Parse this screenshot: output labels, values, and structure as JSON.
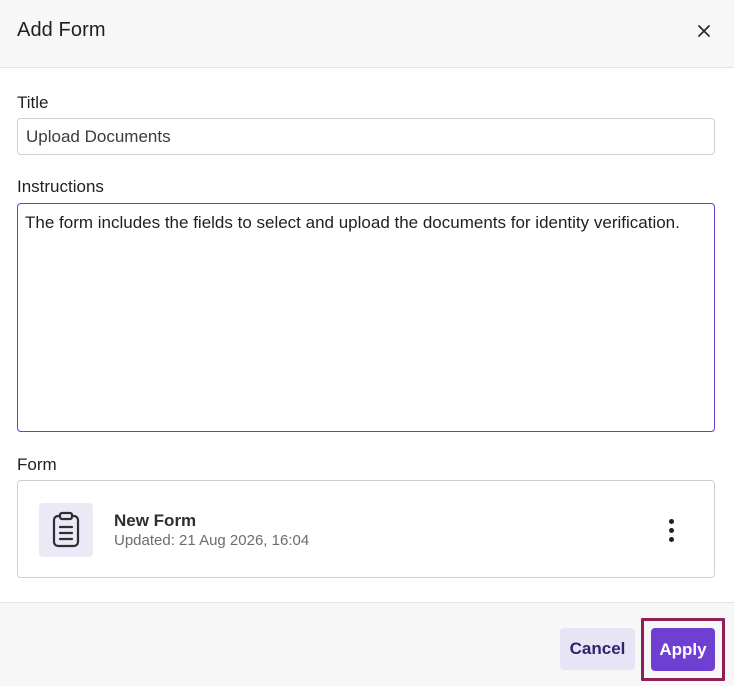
{
  "dialog": {
    "title": "Add Form",
    "close_icon": "close-icon"
  },
  "fields": {
    "title_label": "Title",
    "title_value": "Upload Documents",
    "instructions_label": "Instructions",
    "instructions_value": "The form includes the fields to select and upload the documents for identity verification.",
    "form_label": "Form"
  },
  "form_card": {
    "icon": "clipboard-icon",
    "name": "New Form",
    "updated": "Updated: 21 Aug 2026, 16:04",
    "menu_icon": "more-vertical-icon"
  },
  "footer": {
    "cancel_label": "Cancel",
    "apply_label": "Apply"
  },
  "colors": {
    "accent": "#6e3fd0",
    "highlight": "#8f1f54",
    "cancel_bg": "#e8e3f5"
  }
}
